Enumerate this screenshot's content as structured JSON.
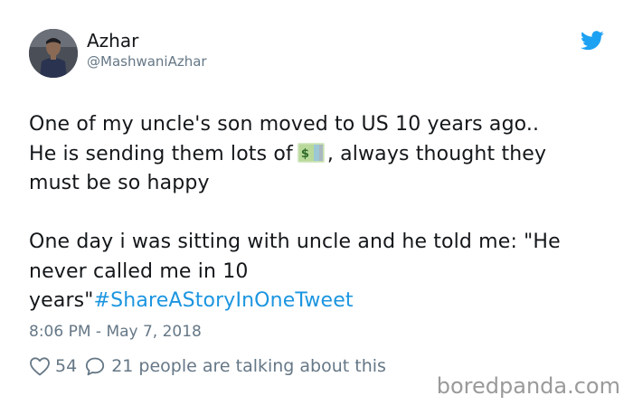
{
  "author": {
    "display_name": "Azhar",
    "handle": "@MashwaniAzhar"
  },
  "tweet": {
    "lines": [
      "One of my uncle's son moved to US 10 years ago..",
      "He is sending them lots of",
      ", always thought they",
      "must be so happy",
      "One day i was sitting with uncle and he told me: \"He",
      "never called me in 10",
      "years\"",
      "#ShareAStoryInOneTweet"
    ],
    "emoji": "money-with-dollar-sign"
  },
  "timestamp": "8:06 PM - May 7, 2018",
  "engagement": {
    "likes": "54",
    "replies_text": "21 people are talking about this"
  },
  "watermark": "boredpanda.com",
  "colors": {
    "text": "#14171a",
    "muted": "#657786",
    "link": "#1b95e0",
    "twitter_blue": "#1da1f2"
  }
}
